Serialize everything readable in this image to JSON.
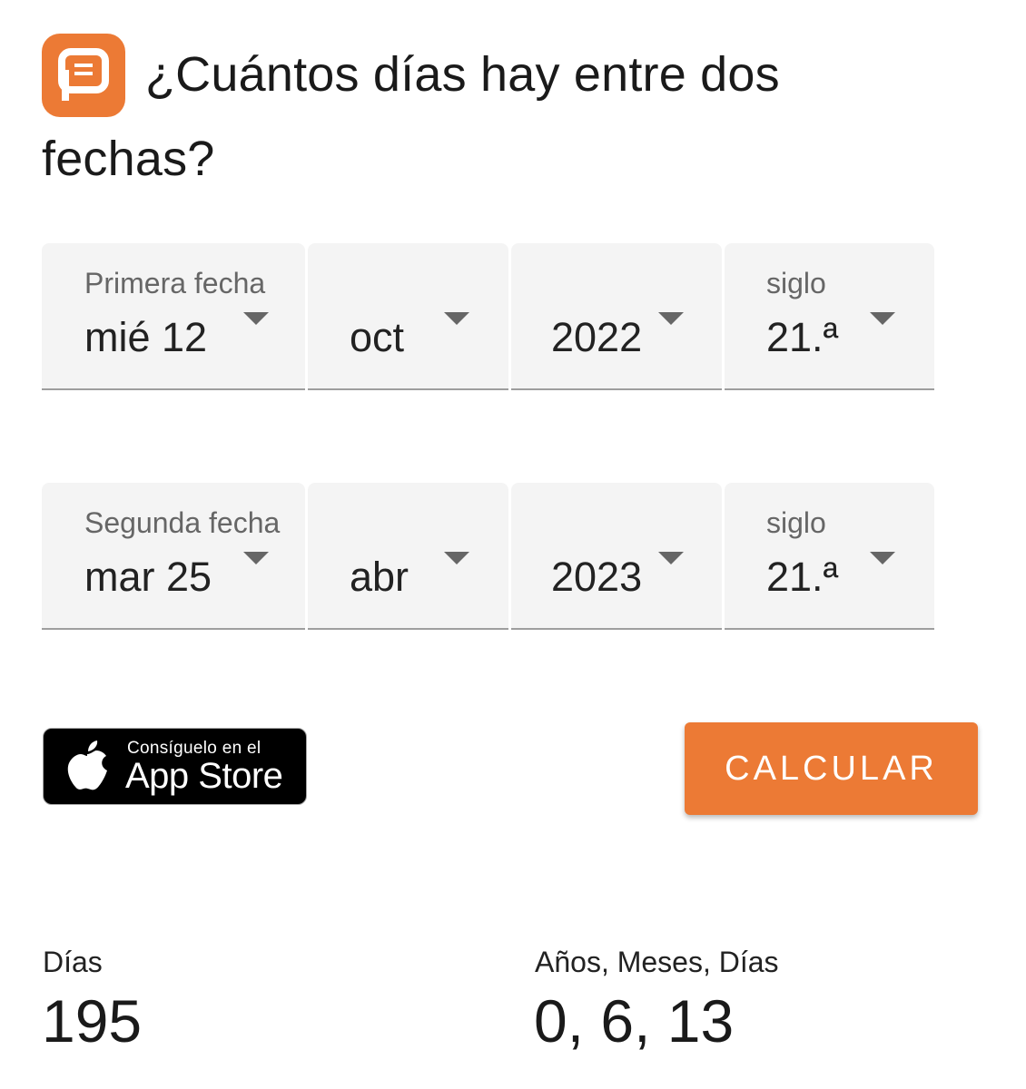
{
  "header": {
    "title_line1": "¿Cuántos días hay entre dos",
    "title_line2": "fechas?",
    "icon": "chat-bubble-icon",
    "accent_color": "#ec7a35"
  },
  "first_date": {
    "label": "Primera fecha",
    "day": "mié 12",
    "month": "oct",
    "year": "2022",
    "century_label": "siglo",
    "century": "21.ª"
  },
  "second_date": {
    "label": "Segunda fecha",
    "day": "mar 25",
    "month": "abr",
    "year": "2023",
    "century_label": "siglo",
    "century": "21.ª"
  },
  "appstore": {
    "line1": "Consíguelo en el",
    "line2": "App Store",
    "icon": "apple-icon"
  },
  "calculate_button": {
    "label": "CALCULAR"
  },
  "results": {
    "days_label": "Días",
    "days_value": "195",
    "ymd_label": "Años, Meses, Días",
    "ymd_value": "0, 6, 13"
  }
}
